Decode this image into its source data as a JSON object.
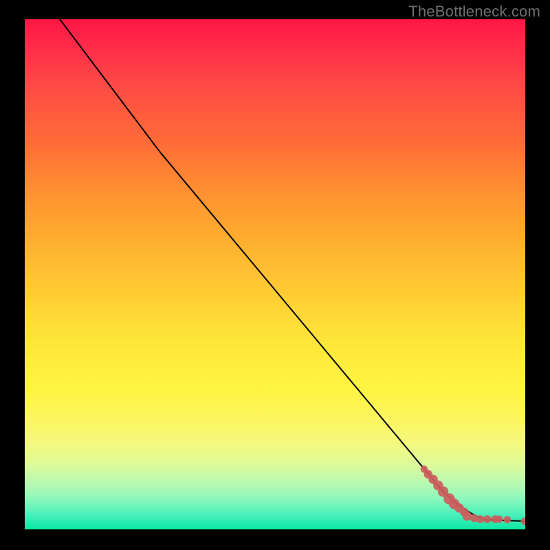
{
  "attribution": "TheBottleneck.com",
  "chart_data": {
    "type": "line",
    "title": "",
    "xlabel": "",
    "ylabel": "",
    "xlim": [
      0,
      100
    ],
    "ylim": [
      0,
      100
    ],
    "axes_hidden": true,
    "grid": false,
    "curve": [
      {
        "x": 7.0,
        "y": 100.0
      },
      {
        "x": 27.0,
        "y": 74.0
      },
      {
        "x": 83.5,
        "y": 7.5
      },
      {
        "x": 88.0,
        "y": 3.2
      },
      {
        "x": 92.0,
        "y": 1.9
      },
      {
        "x": 100.0,
        "y": 1.6
      }
    ],
    "points": [
      {
        "x": 79.8,
        "y": 11.8,
        "r": 2.2
      },
      {
        "x": 80.6,
        "y": 10.8,
        "r": 2.6
      },
      {
        "x": 81.6,
        "y": 9.8,
        "r": 2.8
      },
      {
        "x": 82.6,
        "y": 8.6,
        "r": 3.0
      },
      {
        "x": 83.6,
        "y": 7.4,
        "r": 3.2
      },
      {
        "x": 84.8,
        "y": 6.0,
        "r": 3.4
      },
      {
        "x": 85.8,
        "y": 5.0,
        "r": 3.2
      },
      {
        "x": 86.8,
        "y": 4.2,
        "r": 2.8
      },
      {
        "x": 87.8,
        "y": 3.4,
        "r": 2.6
      },
      {
        "x": 88.4,
        "y": 2.6,
        "r": 2.8
      },
      {
        "x": 89.8,
        "y": 2.2,
        "r": 2.4
      },
      {
        "x": 91.0,
        "y": 2.0,
        "r": 2.4
      },
      {
        "x": 92.4,
        "y": 2.0,
        "r": 2.4
      },
      {
        "x": 94.0,
        "y": 2.0,
        "r": 2.4
      },
      {
        "x": 94.8,
        "y": 2.0,
        "r": 2.2
      },
      {
        "x": 96.4,
        "y": 1.9,
        "r": 2.2
      },
      {
        "x": 99.8,
        "y": 1.6,
        "r": 2.2
      }
    ],
    "point_color": "#cd5c5c",
    "curve_color": "#000000",
    "curve_width": 2
  }
}
